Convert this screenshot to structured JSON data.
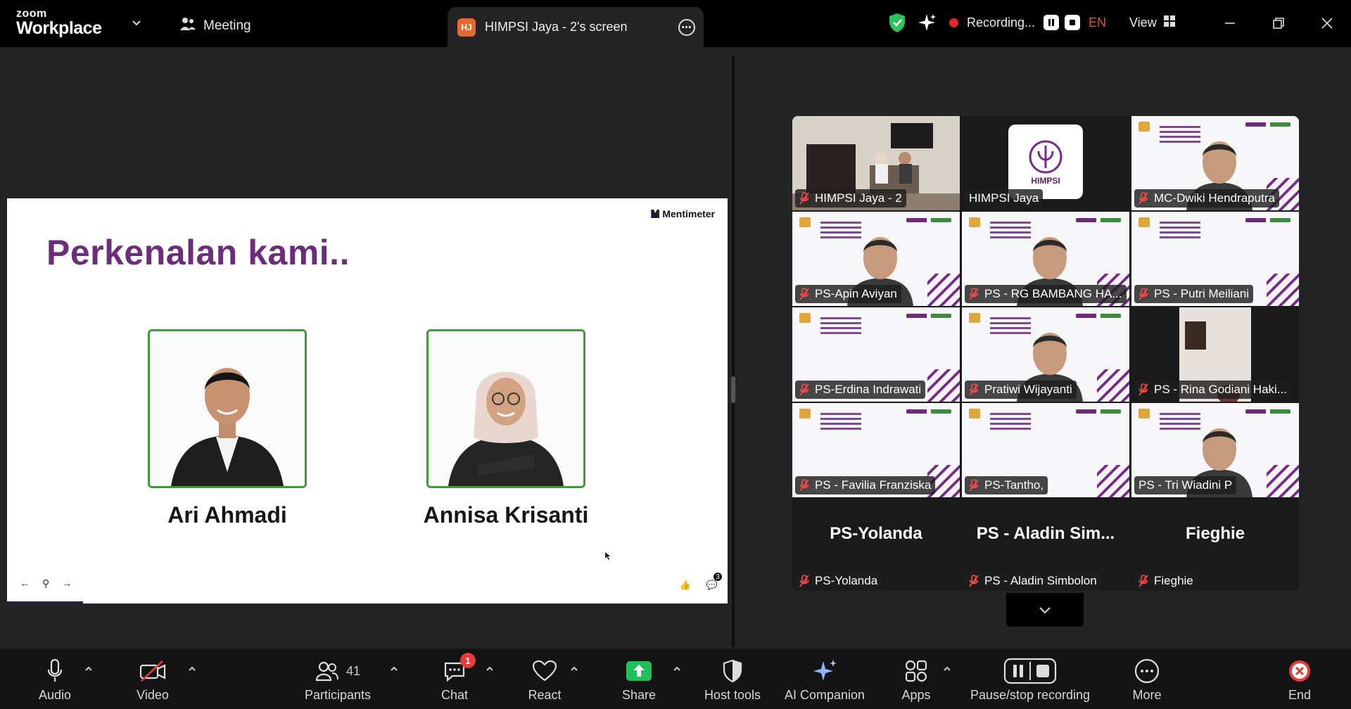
{
  "app": {
    "logo_top": "zoom",
    "logo_bottom": "Workplace"
  },
  "meeting_tab": {
    "label": "Meeting"
  },
  "share_tab": {
    "initials": "HJ",
    "title": "HIMPSI Jaya - 2's screen"
  },
  "recording": {
    "label": "Recording...",
    "language": "EN",
    "view_label": "View"
  },
  "slide": {
    "brand": "Mentimeter",
    "title": "Perkenalan kami..",
    "people": [
      {
        "name": "Ari Ahmadi"
      },
      {
        "name": "Annisa Krisanti"
      }
    ],
    "reaction_count": "3"
  },
  "gallery": {
    "tiles": [
      {
        "name": "HIMPSI Jaya - 2",
        "muted": true,
        "kind": "room"
      },
      {
        "name": "HIMPSI Jaya",
        "muted": false,
        "kind": "logo"
      },
      {
        "name": "MC-Dwiki Hendraputra",
        "muted": true,
        "kind": "slide-person"
      },
      {
        "name": "PS-Apin Aviyan",
        "muted": true,
        "kind": "slide-person"
      },
      {
        "name": "PS - RG BAMBANG HA...",
        "muted": true,
        "kind": "slide-person"
      },
      {
        "name": "PS - Putri Meiliani",
        "muted": true,
        "kind": "slide"
      },
      {
        "name": "PS-Erdina Indrawati",
        "muted": true,
        "kind": "slide"
      },
      {
        "name": "Pratiwi Wijayanti",
        "muted": true,
        "kind": "slide-person"
      },
      {
        "name": "PS - Rina Godiani Haki...",
        "muted": true,
        "kind": "wall"
      },
      {
        "name": "PS - Favilia Franziska",
        "muted": true,
        "kind": "slide"
      },
      {
        "name": "PS-Tantho,",
        "muted": true,
        "kind": "slide"
      },
      {
        "name": "PS - Tri Wiadini P",
        "muted": false,
        "kind": "slide-person"
      },
      {
        "name": "PS-Yolanda",
        "display": "PS-Yolanda",
        "muted": true,
        "kind": "name"
      },
      {
        "name": "PS - Aladin Simbolon",
        "display": "PS - Aladin Sim...",
        "muted": true,
        "kind": "name"
      },
      {
        "name": "Fieghie",
        "display": "Fieghie",
        "muted": true,
        "kind": "name"
      }
    ]
  },
  "toolbar": {
    "audio": "Audio",
    "video": "Video",
    "participants": "Participants",
    "participants_count": "41",
    "chat": "Chat",
    "chat_badge": "1",
    "react": "React",
    "share": "Share",
    "host_tools": "Host tools",
    "ai_companion": "AI Companion",
    "apps": "Apps",
    "pause_recording": "Pause/stop recording",
    "more": "More",
    "end": "End"
  },
  "colors": {
    "accent_green": "#3ee07a",
    "record_red": "#e02828",
    "end_red": "#e43b3b",
    "slide_title": "#6c2d7a",
    "share_green": "#1ec05a"
  }
}
